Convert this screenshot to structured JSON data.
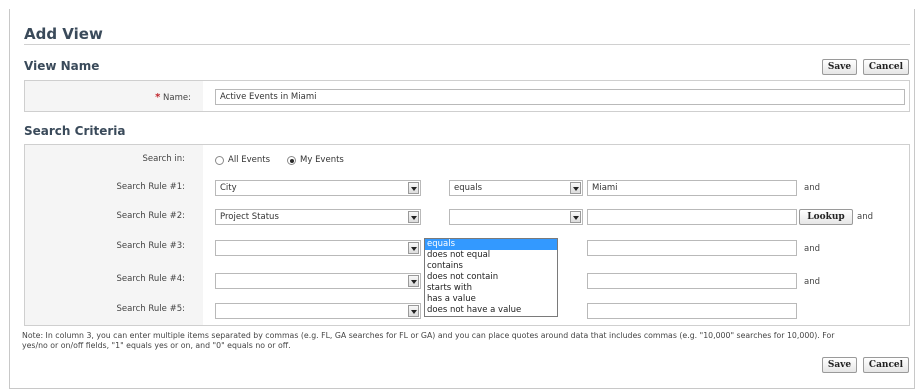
{
  "page": {
    "title": "Add View"
  },
  "view_name_section": {
    "title": "View Name"
  },
  "toolbar_top": {
    "save_label": "Save",
    "cancel_label": "Cancel"
  },
  "name_field": {
    "label": "Name:",
    "required_marker": "*",
    "value": "Active Events in Miami"
  },
  "search_section": {
    "title": "Search Criteria"
  },
  "search_in": {
    "label": "Search in:",
    "options": [
      {
        "label": "All Events",
        "checked": false
      },
      {
        "label": "My Events",
        "checked": true
      }
    ]
  },
  "rules": [
    {
      "label": "Search Rule #1:",
      "field": "City",
      "operator": "equals",
      "value": "Miami",
      "conjunction": "and",
      "lookup": ""
    },
    {
      "label": "Search Rule #2:",
      "field": "Project Status",
      "operator": "",
      "value": "",
      "conjunction": "and",
      "lookup": "Lookup"
    },
    {
      "label": "Search Rule #3:",
      "field": "",
      "operator": "",
      "value": "",
      "conjunction": "and",
      "lookup": ""
    },
    {
      "label": "Search Rule #4:",
      "field": "",
      "operator": "",
      "value": "",
      "conjunction": "and",
      "lookup": ""
    },
    {
      "label": "Search Rule #5:",
      "field": "",
      "operator": "",
      "value": "",
      "conjunction": "",
      "lookup": ""
    }
  ],
  "operator_dropdown": {
    "highlighted": "equals",
    "options": [
      "equals",
      "does not equal",
      "contains",
      "does not contain",
      "starts with",
      "has a value",
      "does not have a value"
    ]
  },
  "note": {
    "line1": "Note: In column 3, you can enter multiple items separated by commas (e.g. FL, GA searches for FL or GA) and you can place quotes around data that includes commas (e.g. \"10,000\" searches for 10,000). For",
    "line2": "yes/no or on/off fields, \"1\" equals yes or on, and \"0\" equals no or off."
  },
  "toolbar_bottom": {
    "save_label": "Save",
    "cancel_label": "Cancel"
  }
}
